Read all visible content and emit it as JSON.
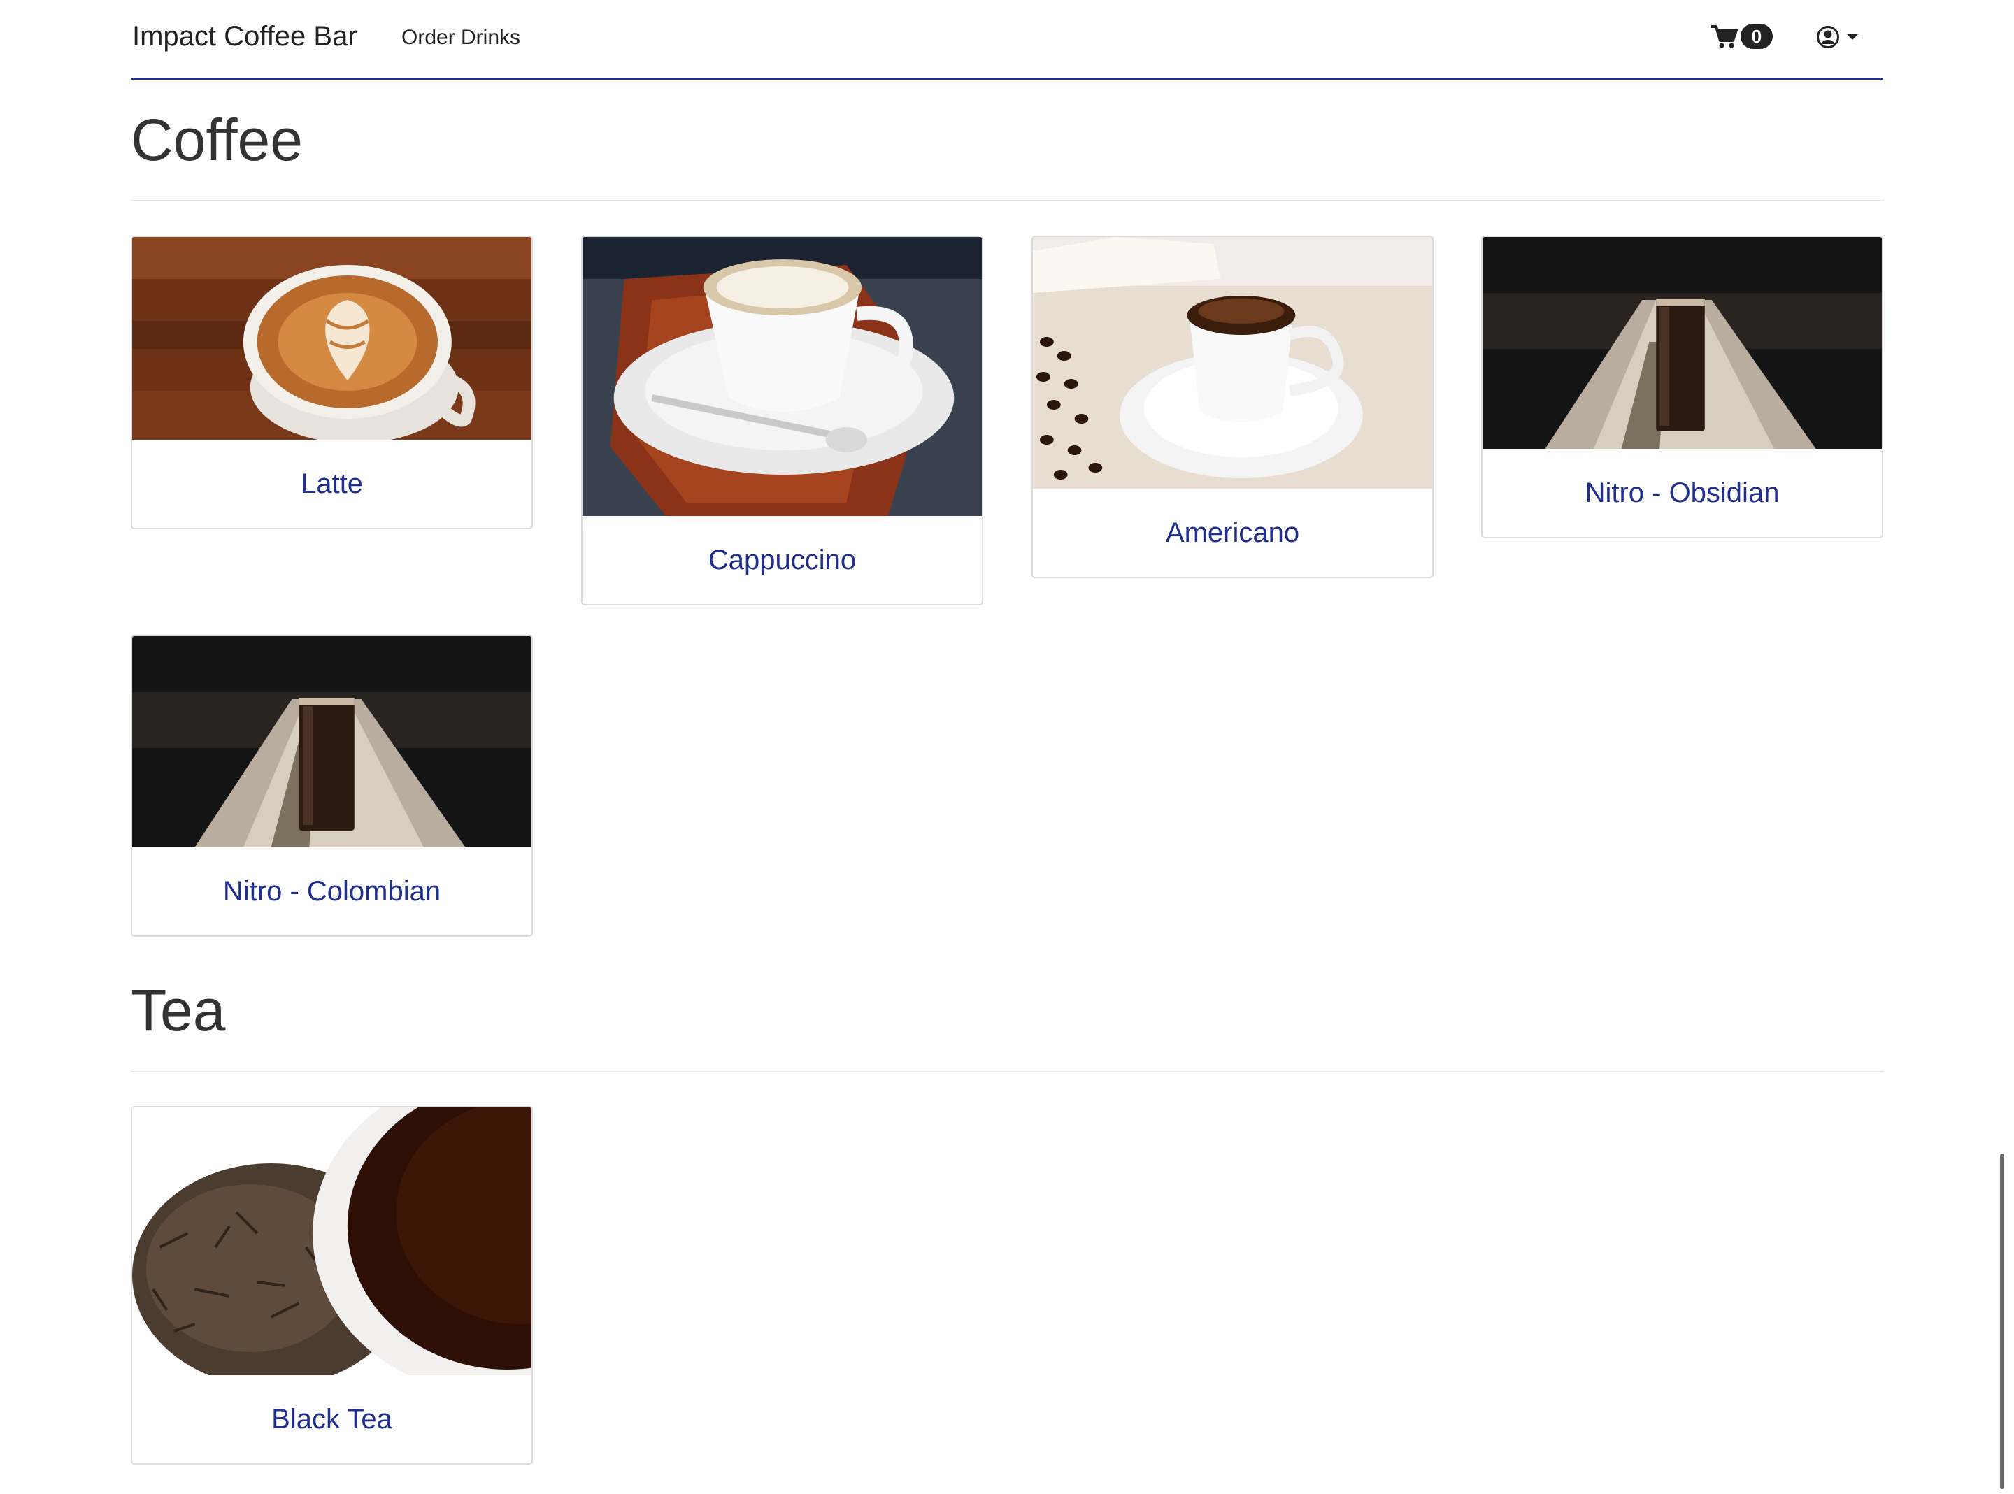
{
  "navbar": {
    "brand": "Impact Coffee Bar",
    "links": [
      {
        "label": "Order Drinks"
      }
    ],
    "cart": {
      "icon": "shopping-cart-icon",
      "count": "0"
    },
    "user": {
      "icon": "user-circle-icon",
      "caret": "caret-down-icon"
    }
  },
  "colors": {
    "accent": "#1f2f8f",
    "badge": "#222222"
  },
  "sections": [
    {
      "title": "Coffee",
      "items": [
        {
          "name": "Latte"
        },
        {
          "name": "Cappuccino"
        },
        {
          "name": "Americano"
        },
        {
          "name": "Nitro - Obsidian"
        },
        {
          "name": "Nitro - Colombian"
        }
      ]
    },
    {
      "title": "Tea",
      "items": [
        {
          "name": "Black Tea"
        }
      ]
    }
  ]
}
